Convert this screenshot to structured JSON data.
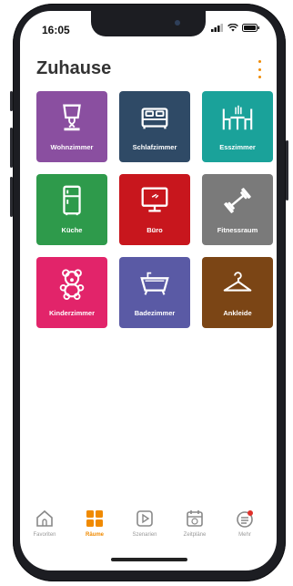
{
  "status": {
    "time": "16:05"
  },
  "header": {
    "title": "Zuhause"
  },
  "rooms": [
    {
      "label": "Wohnzimmer",
      "icon": "lamp-icon",
      "color": "#8a4fa0"
    },
    {
      "label": "Schlafzimmer",
      "icon": "bed-icon",
      "color": "#2f4a66"
    },
    {
      "label": "Esszimmer",
      "icon": "dining-icon",
      "color": "#1aa29a"
    },
    {
      "label": "Küche",
      "icon": "fridge-icon",
      "color": "#2e9a4b"
    },
    {
      "label": "Büro",
      "icon": "monitor-icon",
      "color": "#c8161d"
    },
    {
      "label": "Fitnessraum",
      "icon": "dumbbell-icon",
      "color": "#7a7a7a"
    },
    {
      "label": "Kinderzimmer",
      "icon": "teddy-icon",
      "color": "#e2246a"
    },
    {
      "label": "Badezimmer",
      "icon": "bathtub-icon",
      "color": "#5a5aa5"
    },
    {
      "label": "Ankleide",
      "icon": "hanger-icon",
      "color": "#7b4515"
    }
  ],
  "tabs": [
    {
      "label": "Favoriten",
      "icon": "home-icon"
    },
    {
      "label": "Räume",
      "icon": "rooms-icon"
    },
    {
      "label": "Szenarien",
      "icon": "play-icon"
    },
    {
      "label": "Zeitpläne",
      "icon": "calendar-icon"
    },
    {
      "label": "Mehr",
      "icon": "more-icon"
    }
  ],
  "accent_color": "#f08a00"
}
